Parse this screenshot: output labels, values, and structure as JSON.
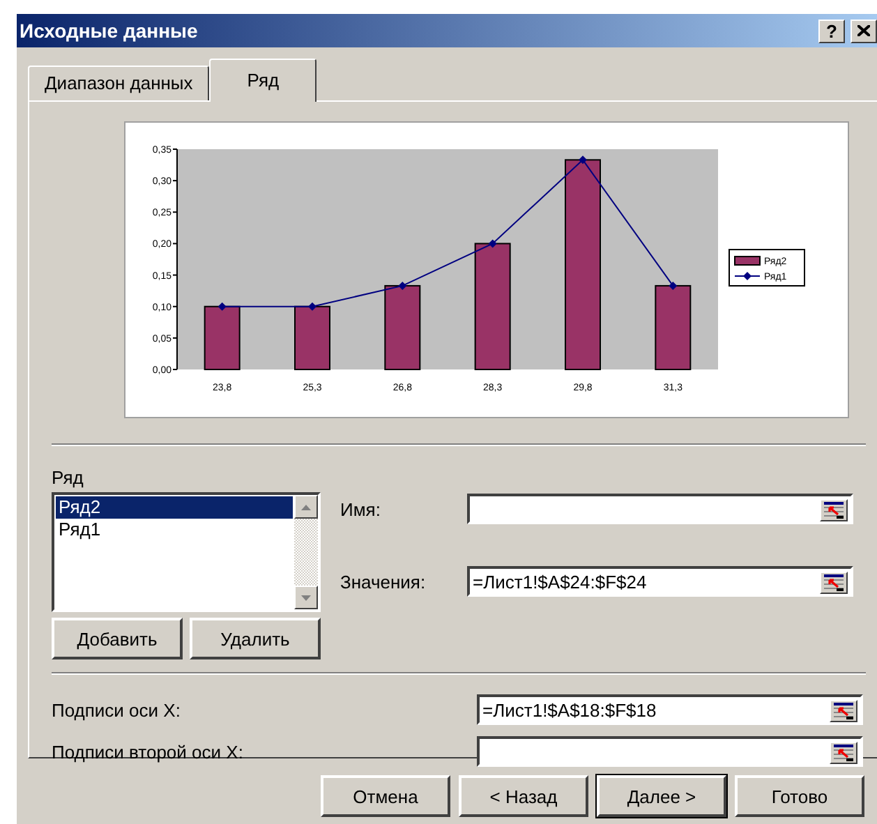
{
  "window": {
    "title": "Исходные данные",
    "help_button": "?"
  },
  "tabs": [
    {
      "label": "Диапазон данных",
      "selected": false
    },
    {
      "label": "Ряд",
      "selected": true
    }
  ],
  "chart": {
    "chart_data": {
      "type": "bar",
      "categories": [
        "23,8",
        "25,3",
        "26,8",
        "28,3",
        "29,8",
        "31,3"
      ],
      "series": [
        {
          "name": "Ряд2",
          "color": "#993366",
          "values": [
            0.1,
            0.1,
            0.133,
            0.2,
            0.333,
            0.133
          ]
        },
        {
          "name": "Ряд1",
          "type": "line",
          "marker": "diamond",
          "color": "#000080",
          "values": [
            0.1,
            0.1,
            0.133,
            0.2,
            0.333,
            0.133
          ]
        }
      ],
      "legend": "right",
      "ylim": [
        0,
        0.35
      ],
      "yticks": [
        {
          "value": 0,
          "label": "0,00"
        },
        {
          "value": 0.05,
          "label": "0,05"
        },
        {
          "value": 0.1,
          "label": "0,10"
        },
        {
          "value": 0.15,
          "label": "0,15"
        },
        {
          "value": 0.2,
          "label": "0,20"
        },
        {
          "value": 0.25,
          "label": "0,25"
        },
        {
          "value": 0.3,
          "label": "0,30"
        },
        {
          "value": 0.35,
          "label": "0,35"
        }
      ]
    }
  },
  "series_list": {
    "label": "Ряд",
    "items": [
      {
        "label": "Ряд2",
        "selected": true
      },
      {
        "label": "Ряд1",
        "selected": false
      }
    ]
  },
  "series_buttons": [
    "Добавить",
    "Удалить"
  ],
  "series_fields": [
    {
      "label": "Имя:"
    },
    {
      "label": "Значения:",
      "value": "=Лист1!$A$24:$F$24"
    }
  ],
  "axis_fields": [
    {
      "label": "Подписи оси X:",
      "value": "=Лист1!$A$18:$F$18"
    },
    {
      "label": "Подписи второй оси X:"
    }
  ],
  "buttons": [
    {
      "label": "Отмена",
      "default": false
    },
    {
      "label": "< Назад",
      "default": false
    },
    {
      "label": "Далее >",
      "default": true
    },
    {
      "label": "Готово",
      "default": false
    }
  ]
}
